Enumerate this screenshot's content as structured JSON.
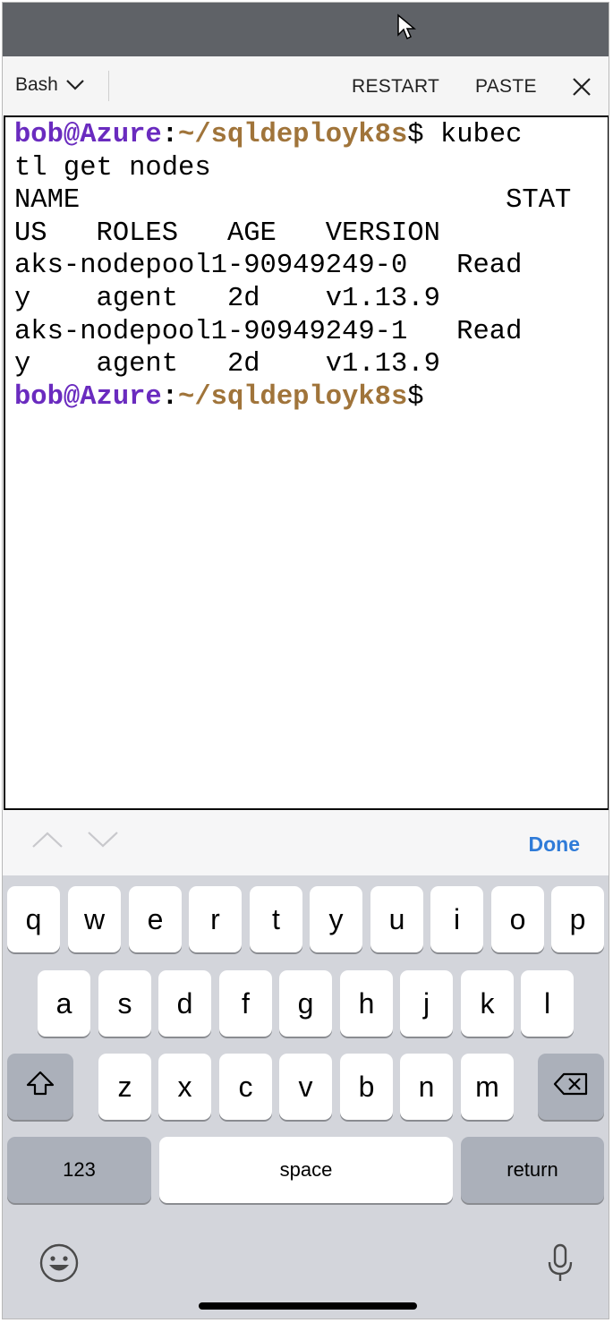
{
  "toolbar": {
    "shell_label": "Bash",
    "restart_label": "RESTART",
    "paste_label": "PASTE"
  },
  "terminal": {
    "prompt_user": "bob@Azure",
    "prompt_colon": ":",
    "prompt_path": "~/sqldeployk8s",
    "prompt_symbol": "$",
    "command_line_1": " kubec",
    "command_line_2": "tl get nodes",
    "output_lines": [
      "NAME                          STAT",
      "US   ROLES   AGE   VERSION",
      "aks-nodepool1-90949249-0   Read",
      "y    agent   2d    v1.13.9",
      "aks-nodepool1-90949249-1   Read",
      "y    agent   2d    v1.13.9"
    ]
  },
  "keyboard_accessory": {
    "done_label": "Done"
  },
  "keyboard": {
    "row1": [
      "q",
      "w",
      "e",
      "r",
      "t",
      "y",
      "u",
      "i",
      "o",
      "p"
    ],
    "row2": [
      "a",
      "s",
      "d",
      "f",
      "g",
      "h",
      "j",
      "k",
      "l"
    ],
    "row3": [
      "z",
      "x",
      "c",
      "v",
      "b",
      "n",
      "m"
    ],
    "numbers_label": "123",
    "space_label": "space",
    "return_label": "return"
  },
  "icons": [
    "cursor-icon",
    "chevron-down-icon",
    "close-icon",
    "arrow-up-icon",
    "arrow-down-icon",
    "shift-icon",
    "backspace-icon",
    "emoji-icon",
    "microphone-icon"
  ]
}
